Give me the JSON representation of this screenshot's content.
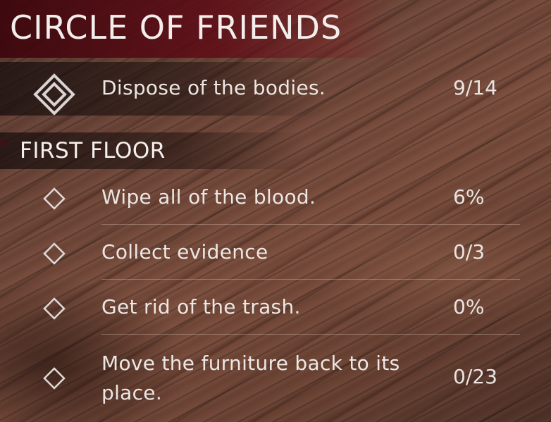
{
  "title": "CIRCLE OF FRIENDS",
  "main_task": {
    "icon": "double-diamond-icon",
    "label": "Dispose of the bodies.",
    "value": "9/14"
  },
  "section": {
    "title": "FIRST FLOOR",
    "tasks": [
      {
        "icon": "diamond-icon",
        "label": "Wipe all of the blood.",
        "value": "6%"
      },
      {
        "icon": "diamond-icon",
        "label": "Collect evidence",
        "value": "0/3"
      },
      {
        "icon": "diamond-icon",
        "label": "Get rid of the trash.",
        "value": "0%"
      },
      {
        "icon": "diamond-icon",
        "label": "Move the furniture back to its place.",
        "value": "0/23"
      }
    ]
  },
  "colors": {
    "title_band": "#5f0c16",
    "accent_red": "#c3122a",
    "text": "#ece7e4",
    "wood": "#6e4638"
  }
}
